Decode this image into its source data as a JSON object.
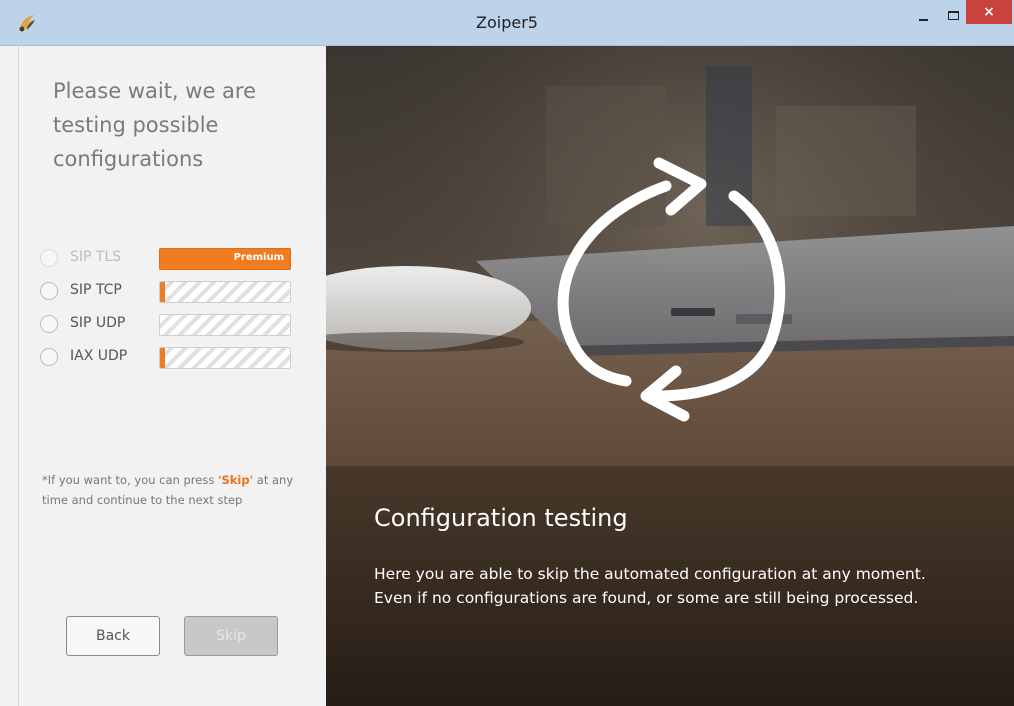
{
  "window": {
    "title": "Zoiper5",
    "close_glyph": "×"
  },
  "left": {
    "heading": "Please wait, we are testing possible configurations",
    "options": [
      {
        "label": "SIP TLS",
        "progress": 1.0,
        "badge": "Premium",
        "disabled": true
      },
      {
        "label": "SIP TCP",
        "progress": 0.04,
        "disabled": false
      },
      {
        "label": "SIP UDP",
        "progress": 0.0,
        "disabled": false
      },
      {
        "label": "IAX UDP",
        "progress": 0.04,
        "disabled": false
      }
    ],
    "note_prefix": "*If you want to, you can press ",
    "note_highlight": "'Skip'",
    "note_suffix": " at any time and continue to the next step",
    "back_label": "Back",
    "skip_label": "Skip"
  },
  "hero": {
    "title": "Configuration testing",
    "description": "Here you are able to skip the automated configuration at any moment. Even if no configurations are found, or some are still being processed."
  },
  "colors": {
    "accent": "#f07c21",
    "titlebar": "#bcd3ea",
    "close": "#c7433b"
  }
}
